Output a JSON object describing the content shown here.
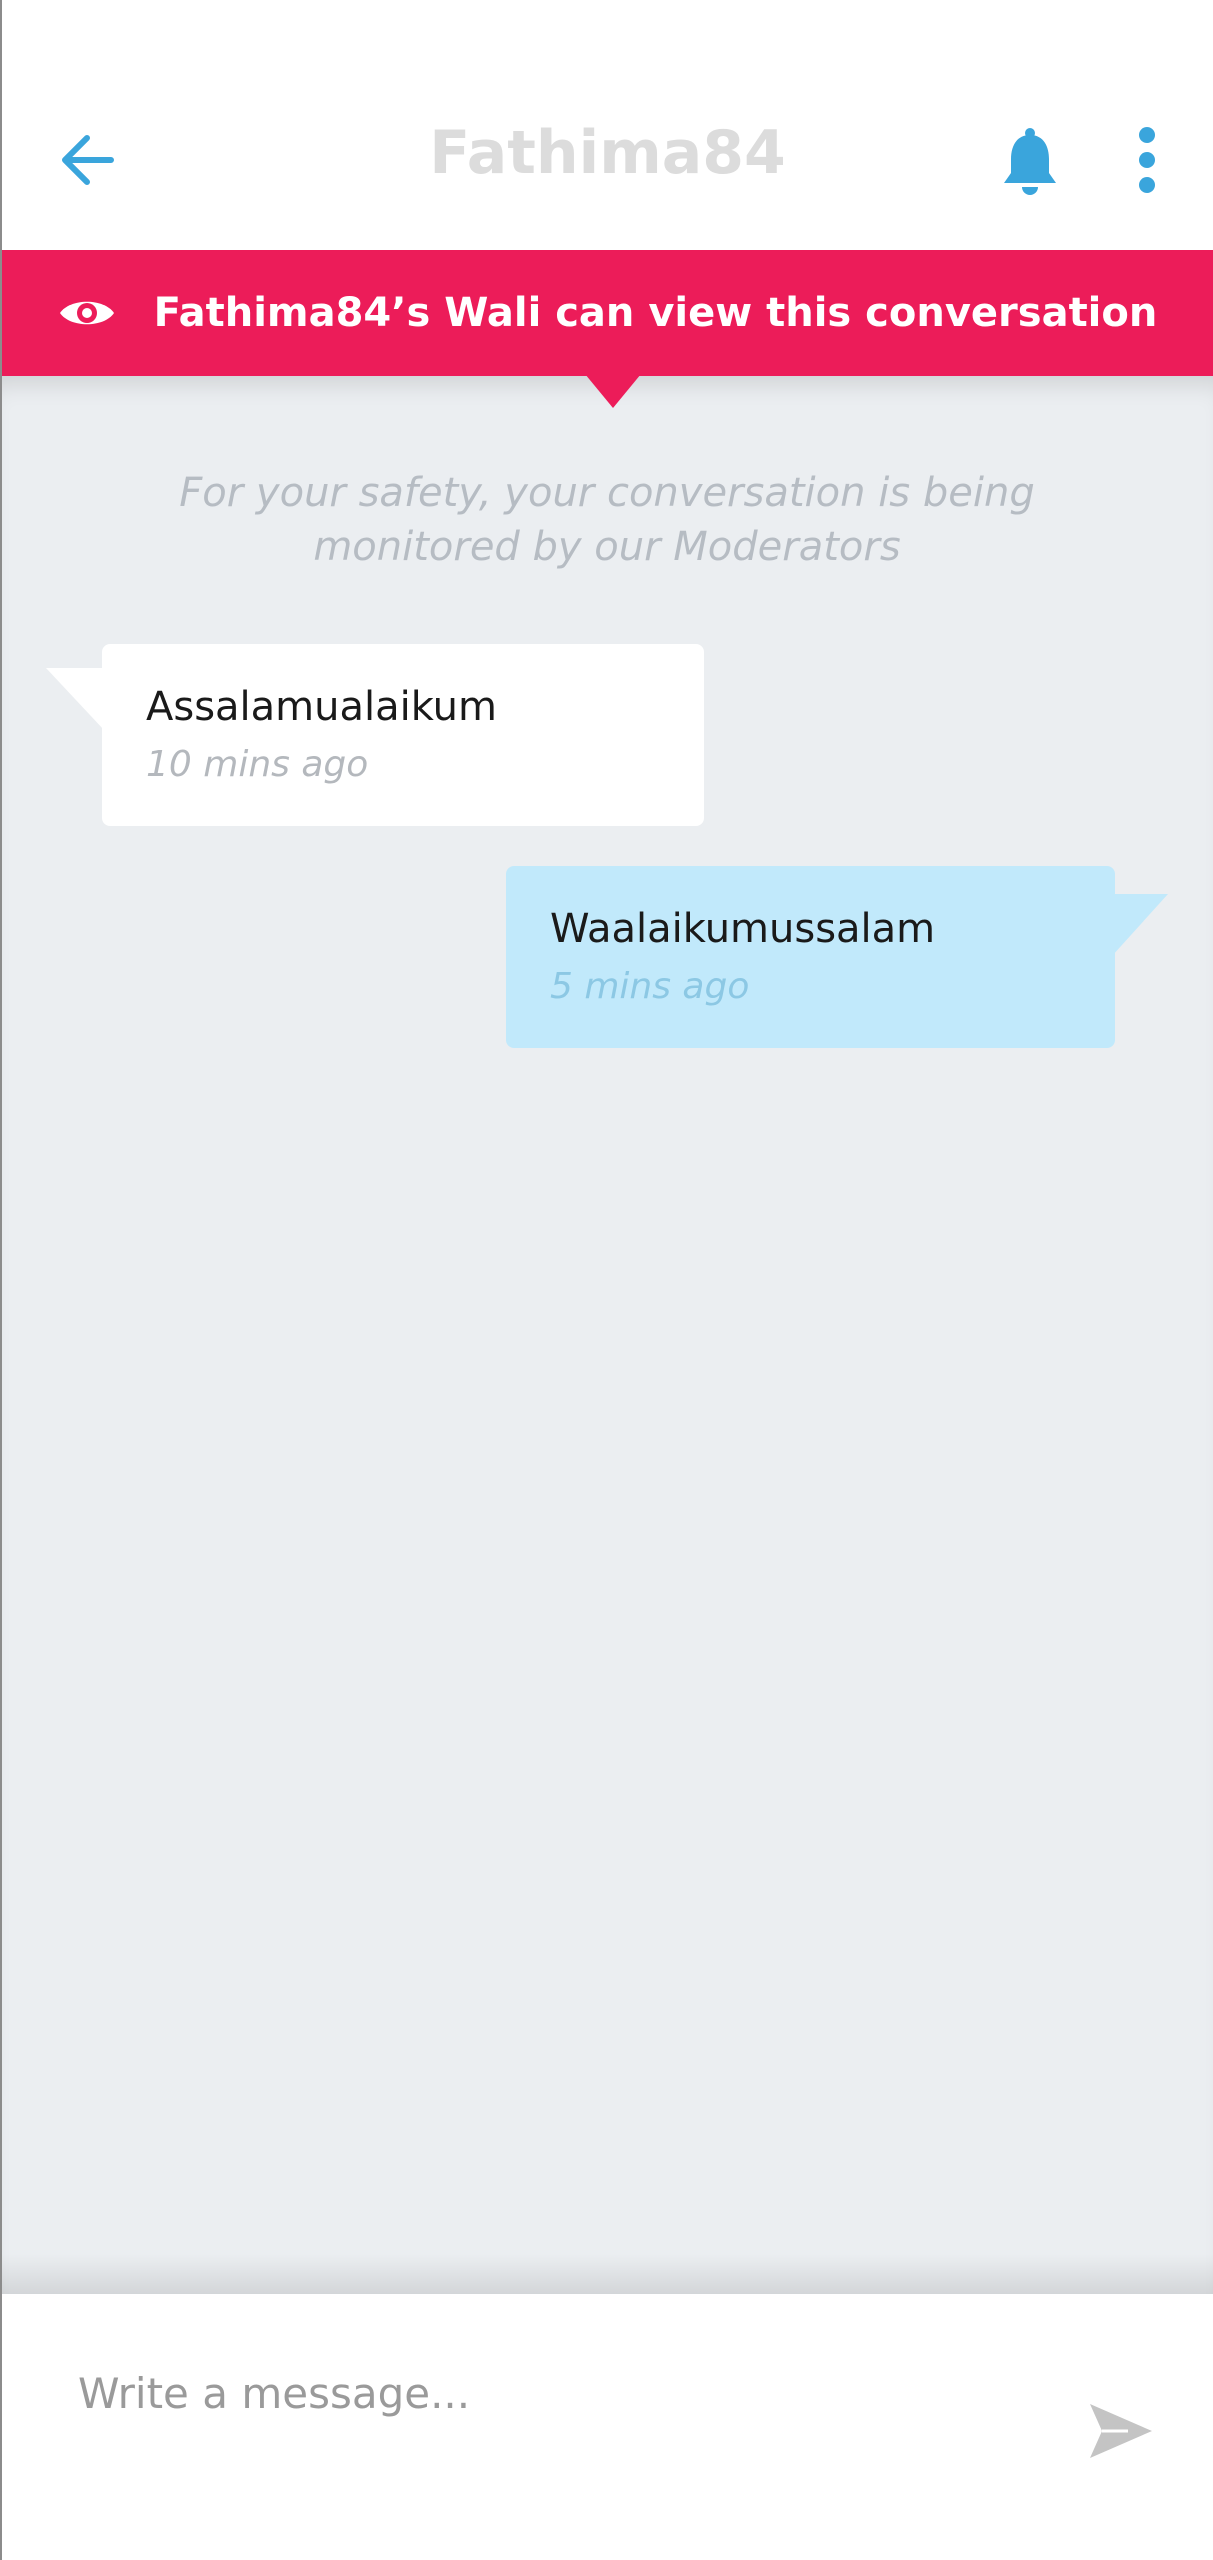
{
  "header": {
    "title": "Fathima84",
    "back_icon": "arrow-left-icon",
    "bell_icon": "bell-icon",
    "more_icon": "more-vertical-icon",
    "accent_color": "#3aa5dc"
  },
  "banner": {
    "text": "Fathima84’s Wali can view this conversation",
    "icon": "eye-icon",
    "background_color": "#ec1c59"
  },
  "chat": {
    "safety_note": "For your safety, your conversation is being monitored by our Moderators",
    "messages": [
      {
        "direction": "incoming",
        "text": "Assalamualaikum",
        "time": "10 mins ago"
      },
      {
        "direction": "outgoing",
        "text": "Waalaikumussalam",
        "time": "5 mins ago"
      }
    ]
  },
  "composer": {
    "placeholder": "Write a message...",
    "send_icon": "send-icon"
  }
}
